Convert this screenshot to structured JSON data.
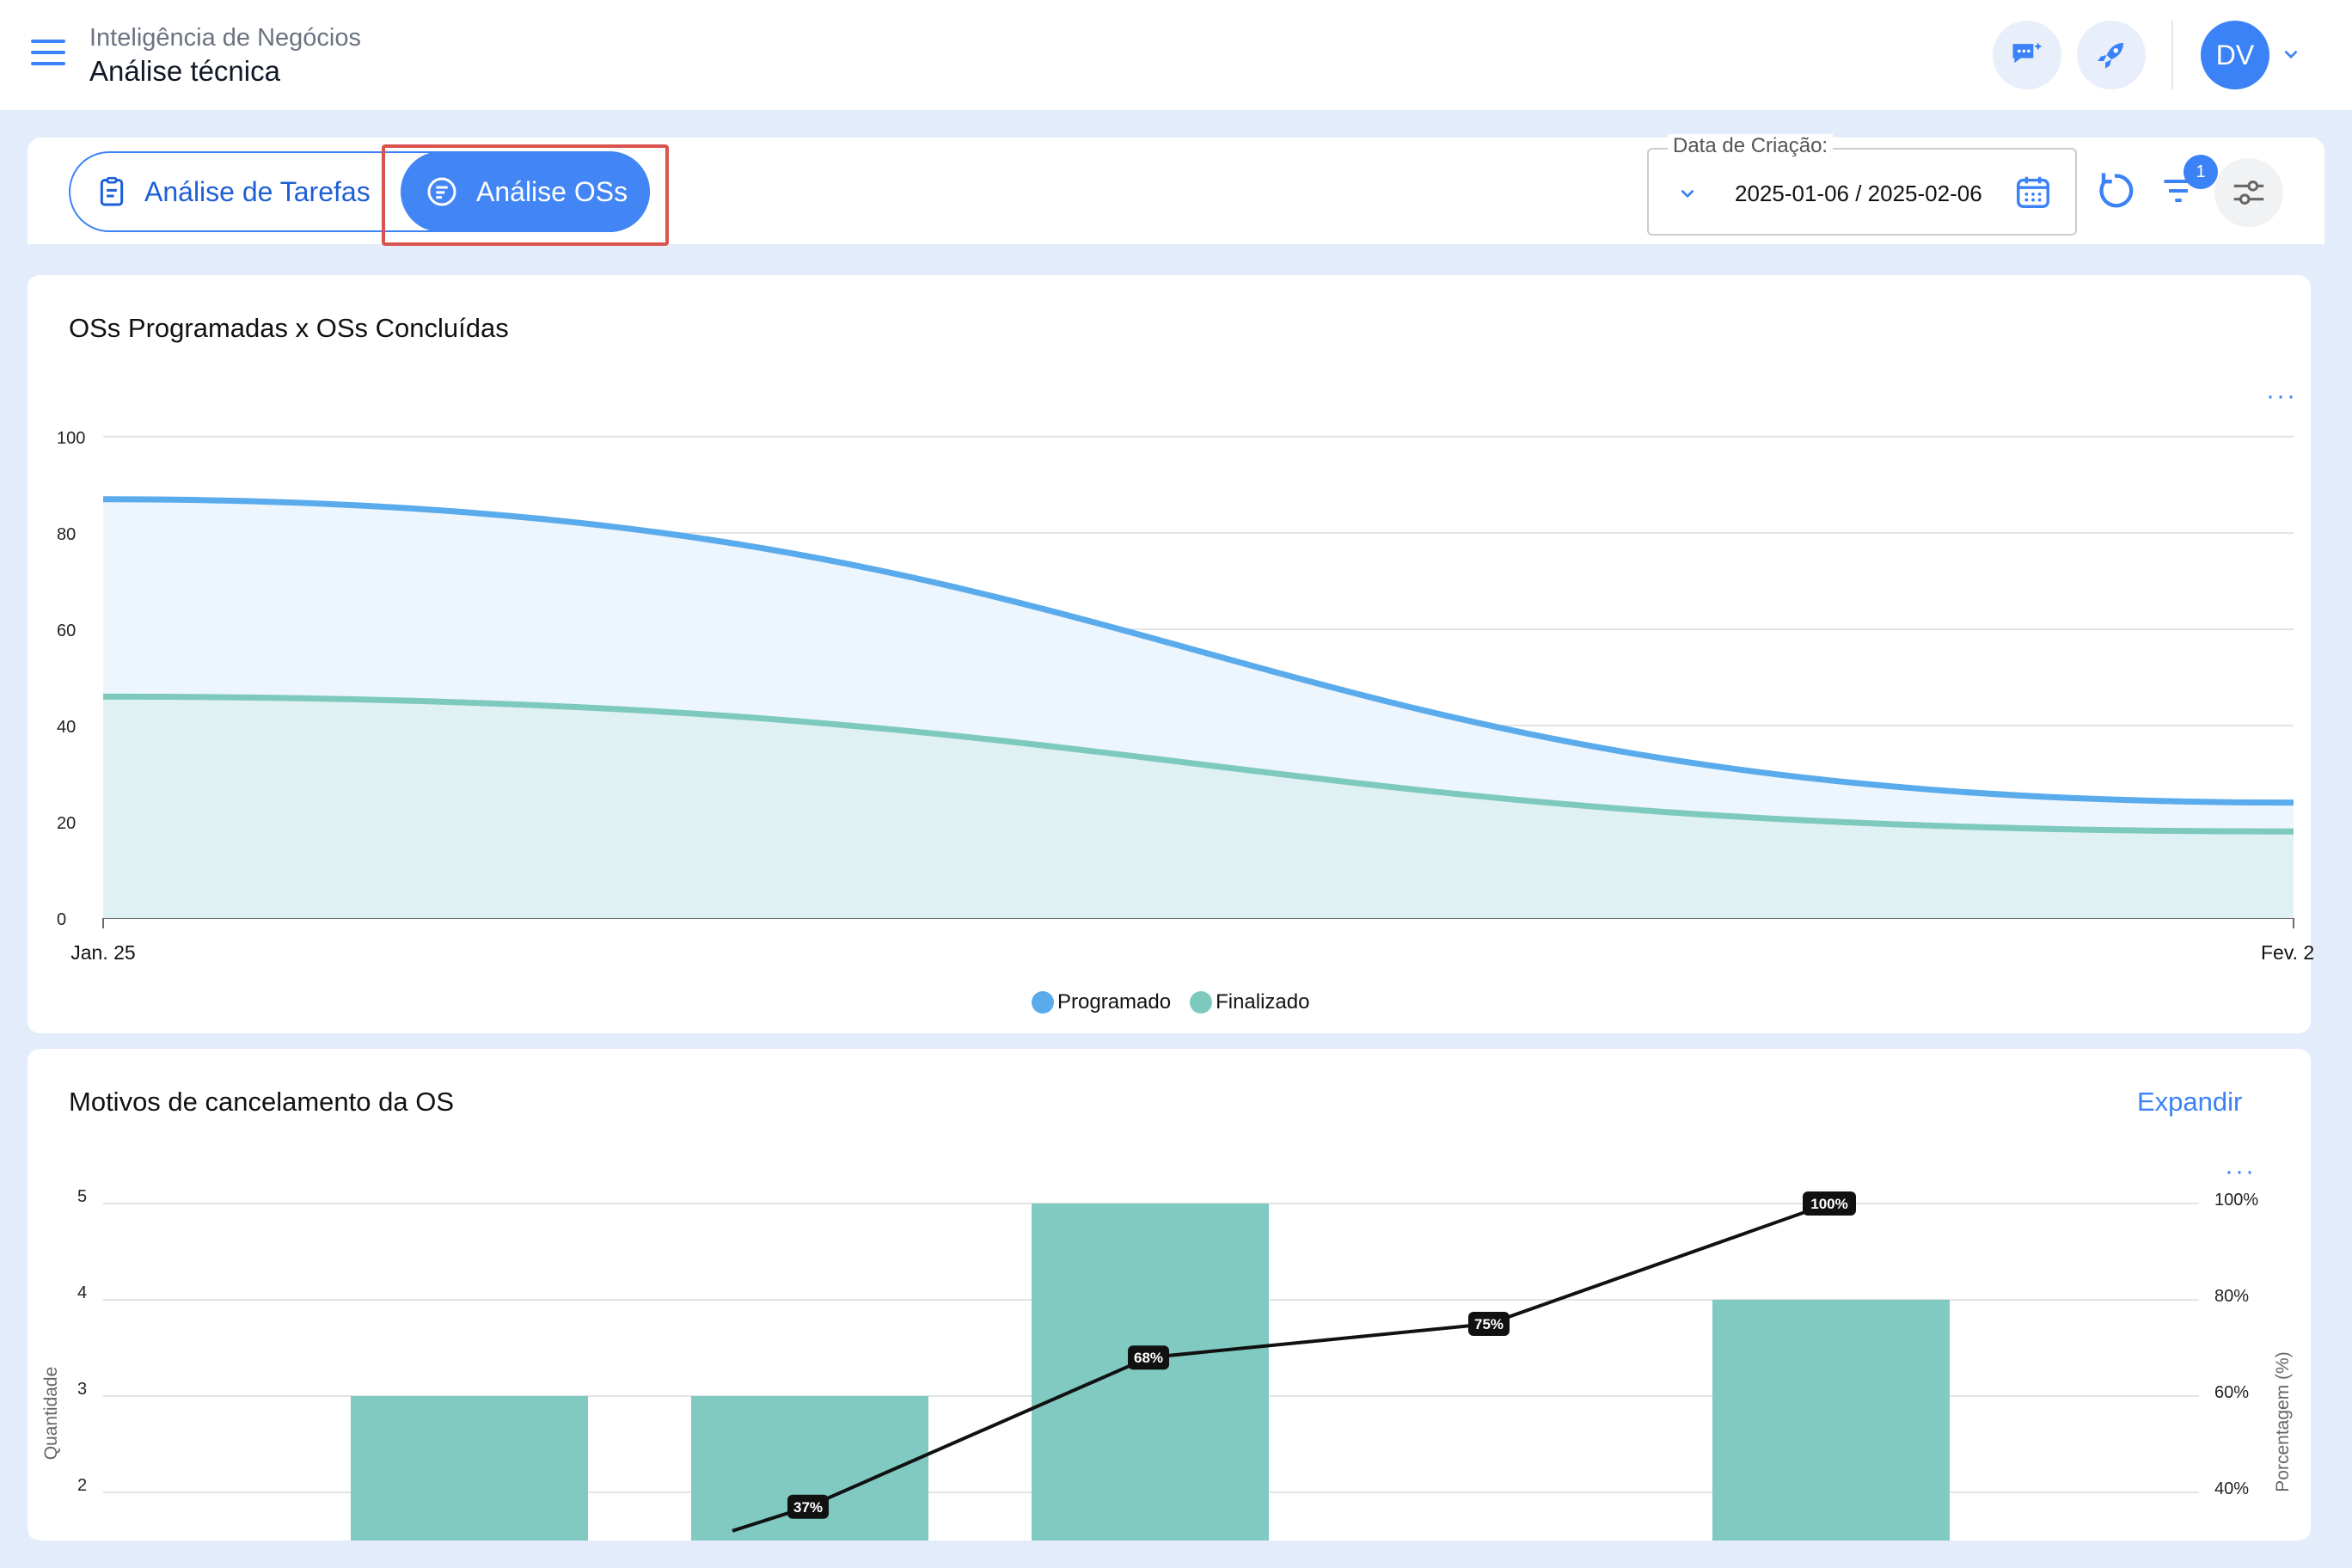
{
  "header": {
    "breadcrumb": "Inteligência de Negócios",
    "title": "Análise técnica",
    "avatar_initials": "DV"
  },
  "toolbar": {
    "tab_tarefas": "Análise de Tarefas",
    "tab_os": "Análise OSs",
    "date_label": "Data de Criação:",
    "date_value": "2025-01-06 / 2025-02-06",
    "filter_count": "1"
  },
  "colors": {
    "accent": "#3b82f6",
    "programado": "#5aabec",
    "finalizado": "#7ec9be",
    "bar": "#80cac1"
  },
  "card1": {
    "title": "OSs Programadas x OSs Concluídas",
    "more": "···"
  },
  "card2": {
    "title": "Motivos de cancelamento da OS",
    "expand": "Expandir",
    "more": "···"
  },
  "chart_data": [
    {
      "type": "area",
      "title": "OSs Programadas x OSs Concluídas",
      "x": [
        "Jan. 25",
        "Fev. 2"
      ],
      "xlabels": [
        "Jan. 25",
        "Fev. 2"
      ],
      "ylim": [
        0,
        100
      ],
      "yticks": [
        0,
        20,
        40,
        60,
        80,
        100
      ],
      "series": [
        {
          "name": "Programado",
          "values": [
            87,
            24
          ]
        },
        {
          "name": "Finalizado",
          "values": [
            46,
            18
          ]
        }
      ],
      "grid": true,
      "legend": "bottom-center"
    },
    {
      "type": "bar",
      "title": "Motivos de cancelamento da OS",
      "ylabel": "Quantidade",
      "y2label": "Porcentagem (%)",
      "ylim_visible": [
        2,
        5
      ],
      "yticks": [
        2,
        3,
        4,
        5
      ],
      "y2ticks": [
        "40%",
        "60%",
        "80%",
        "100%"
      ],
      "values": [
        3,
        3,
        5,
        0,
        4
      ],
      "cumulative_percent": [
        null,
        37,
        68,
        75,
        100
      ],
      "cumulative_labels": [
        "",
        "37%",
        "68%",
        "75%",
        "100%"
      ],
      "grid": true
    }
  ]
}
